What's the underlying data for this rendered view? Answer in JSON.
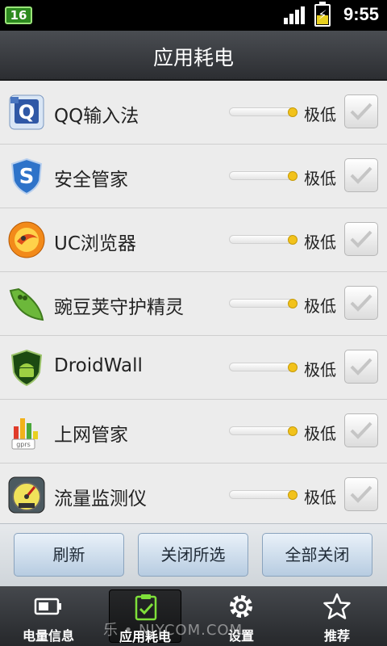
{
  "status_bar": {
    "notification_count": "16",
    "time": "9:55",
    "icons": [
      "notification-badge",
      "signal-icon",
      "battery-charging-icon"
    ]
  },
  "header": {
    "title": "应用耗电"
  },
  "apps": [
    {
      "name": "QQ输入法",
      "level": "极低",
      "icon": "qq-input-icon",
      "checked": false
    },
    {
      "name": "安全管家",
      "level": "极低",
      "icon": "security-shield-icon",
      "checked": false
    },
    {
      "name": "UC浏览器",
      "level": "极低",
      "icon": "uc-browser-icon",
      "checked": false
    },
    {
      "name": "豌豆荚守护精灵",
      "level": "极低",
      "icon": "pea-pod-icon",
      "checked": false
    },
    {
      "name": "DroidWall",
      "level": "极低",
      "icon": "android-shield-icon",
      "checked": false
    },
    {
      "name": "上网管家",
      "level": "极低",
      "icon": "gprs-chart-icon",
      "checked": false
    },
    {
      "name": "流量监测仪",
      "level": "极低",
      "icon": "speedometer-icon",
      "checked": false
    }
  ],
  "buttons": {
    "refresh": "刷新",
    "close_selected": "关闭所选",
    "close_all": "全部关闭"
  },
  "nav": [
    {
      "label": "电量信息",
      "icon": "battery-icon",
      "active": false
    },
    {
      "label": "应用耗电",
      "icon": "checklist-icon",
      "active": true
    },
    {
      "label": "设置",
      "icon": "gear-icon",
      "active": false
    },
    {
      "label": "推荐",
      "icon": "star-icon",
      "active": false
    }
  ],
  "watermark": "乐 • NJYCOM.COM",
  "colors": {
    "accent_green": "#7fe03a",
    "slider_knob": "#f2c21b",
    "button_blue": "#b7cce1"
  }
}
